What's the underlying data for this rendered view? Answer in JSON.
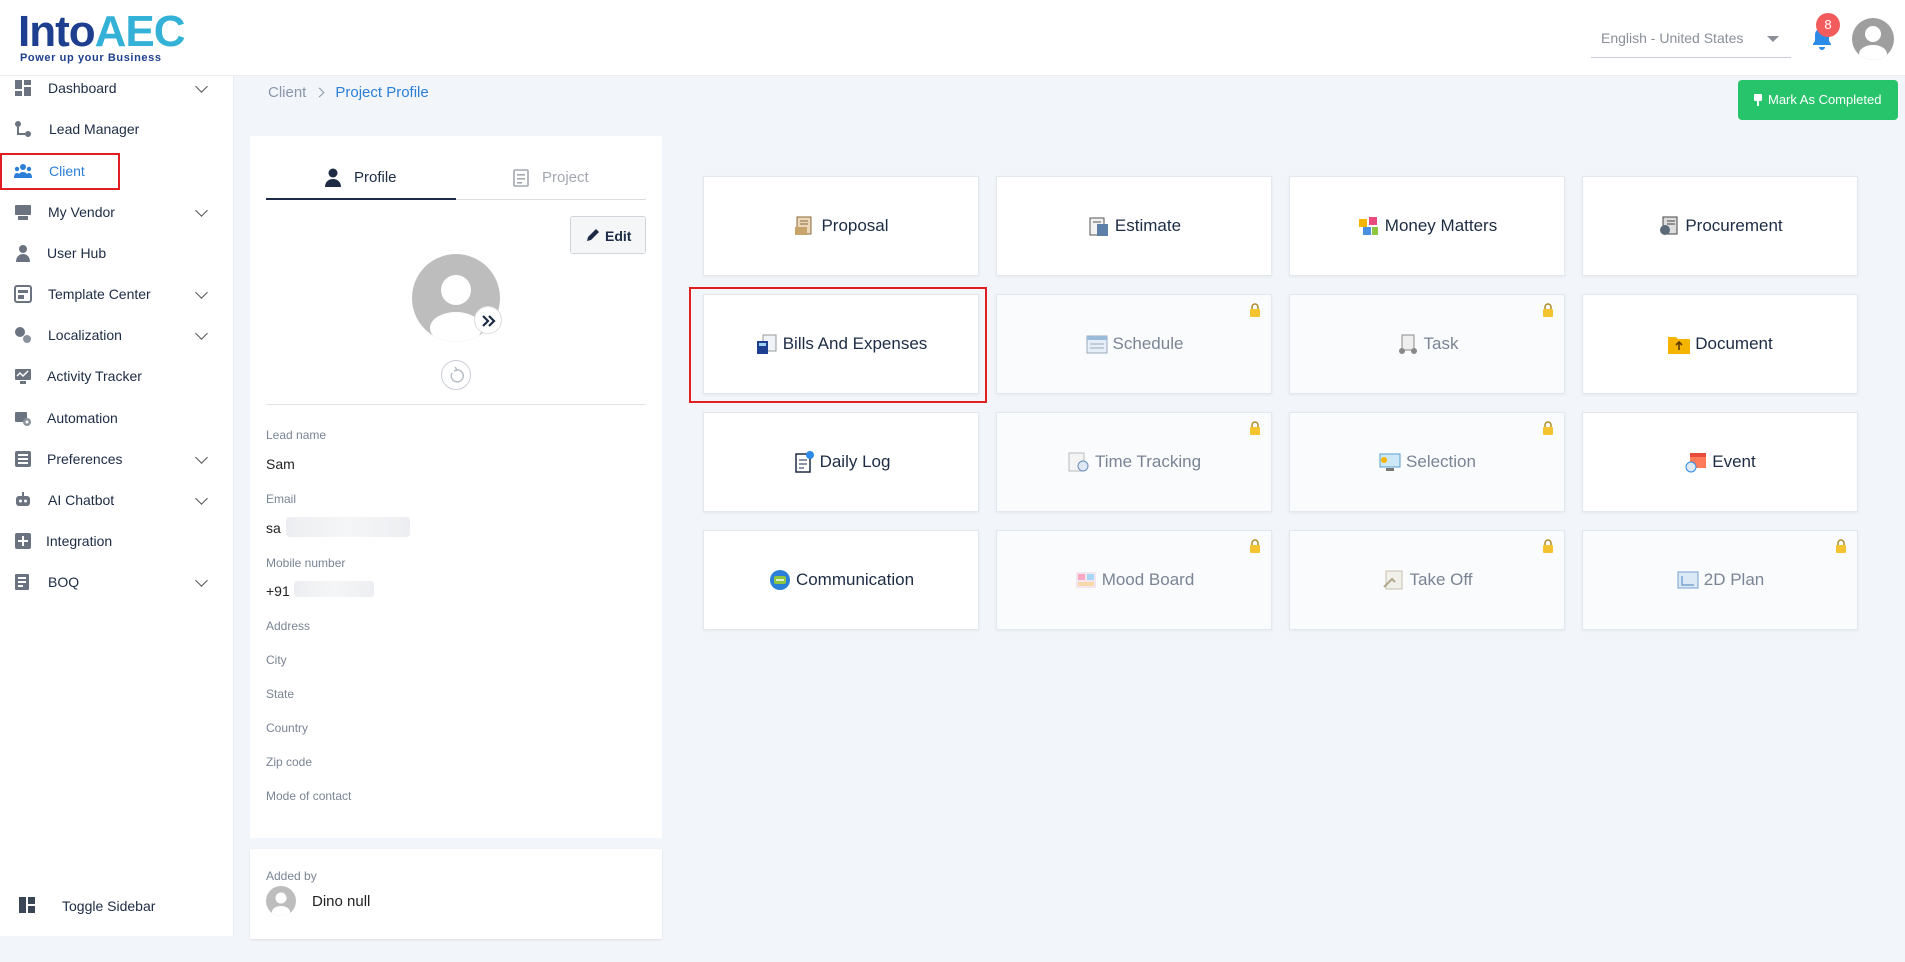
{
  "header": {
    "logo_main": "Into",
    "logo_accent": "AEC",
    "logo_tagline": "Power up your Business",
    "language": "English - United States",
    "notification_count": "8"
  },
  "sidebar": {
    "items": [
      {
        "label": "Dashboard",
        "icon": "dashboard-icon",
        "has_chevron": true
      },
      {
        "label": "Lead Manager",
        "icon": "lead-manager-icon",
        "has_chevron": false
      },
      {
        "label": "Client",
        "icon": "client-icon",
        "has_chevron": false,
        "active": true
      },
      {
        "label": "My Vendor",
        "icon": "vendor-icon",
        "has_chevron": true
      },
      {
        "label": "User Hub",
        "icon": "user-icon",
        "has_chevron": false
      },
      {
        "label": "Template Center",
        "icon": "template-icon",
        "has_chevron": true
      },
      {
        "label": "Localization",
        "icon": "localization-icon",
        "has_chevron": true
      },
      {
        "label": "Activity Tracker",
        "icon": "activity-icon",
        "has_chevron": false
      },
      {
        "label": "Automation",
        "icon": "automation-icon",
        "has_chevron": false
      },
      {
        "label": "Preferences",
        "icon": "preferences-icon",
        "has_chevron": true
      },
      {
        "label": "AI Chatbot",
        "icon": "chatbot-icon",
        "has_chevron": true
      },
      {
        "label": "Integration",
        "icon": "integration-icon",
        "has_chevron": false
      },
      {
        "label": "BOQ",
        "icon": "boq-icon",
        "has_chevron": true
      }
    ],
    "toggle_label": "Toggle Sidebar"
  },
  "breadcrumb": {
    "parent": "Client",
    "current": "Project Profile"
  },
  "actions": {
    "mark_completed": "Mark As Completed"
  },
  "profile": {
    "tabs": {
      "profile": "Profile",
      "project": "Project"
    },
    "edit_label": "Edit",
    "fields": {
      "lead_name_label": "Lead name",
      "lead_name_value": "Sam",
      "email_label": "Email",
      "email_value": "sa",
      "mobile_label": "Mobile number",
      "mobile_value": "+91",
      "address_label": "Address",
      "city_label": "City",
      "state_label": "State",
      "country_label": "Country",
      "zip_label": "Zip code",
      "contact_mode_label": "Mode of contact"
    },
    "added_by_label": "Added by",
    "added_by_name": "Dino null"
  },
  "modules": [
    {
      "name": "Proposal",
      "icon": "proposal-icon",
      "locked": false
    },
    {
      "name": "Estimate",
      "icon": "estimate-icon",
      "locked": false
    },
    {
      "name": "Money Matters",
      "icon": "money-matters-icon",
      "locked": false
    },
    {
      "name": "Procurement",
      "icon": "procurement-icon",
      "locked": false
    },
    {
      "name": "Bills And Expenses",
      "icon": "bills-icon",
      "locked": false
    },
    {
      "name": "Schedule",
      "icon": "schedule-icon",
      "locked": true
    },
    {
      "name": "Task",
      "icon": "task-icon",
      "locked": true
    },
    {
      "name": "Document",
      "icon": "document-icon",
      "locked": false
    },
    {
      "name": "Daily Log",
      "icon": "daily-log-icon",
      "locked": false
    },
    {
      "name": "Time Tracking",
      "icon": "time-tracking-icon",
      "locked": true
    },
    {
      "name": "Selection",
      "icon": "selection-icon",
      "locked": true
    },
    {
      "name": "Event",
      "icon": "event-icon",
      "locked": false
    },
    {
      "name": "Communication",
      "icon": "communication-icon",
      "locked": false
    },
    {
      "name": "Mood Board",
      "icon": "mood-board-icon",
      "locked": true
    },
    {
      "name": "Take Off",
      "icon": "take-off-icon",
      "locked": true
    },
    {
      "name": "2D Plan",
      "icon": "2d-plan-icon",
      "locked": true
    }
  ],
  "colors": {
    "brand_blue": "#1e3f8f",
    "accent_cyan": "#33b1d6",
    "link_blue": "#2b7fd8",
    "success_green": "#27c46b",
    "highlight_red": "#e02020"
  }
}
